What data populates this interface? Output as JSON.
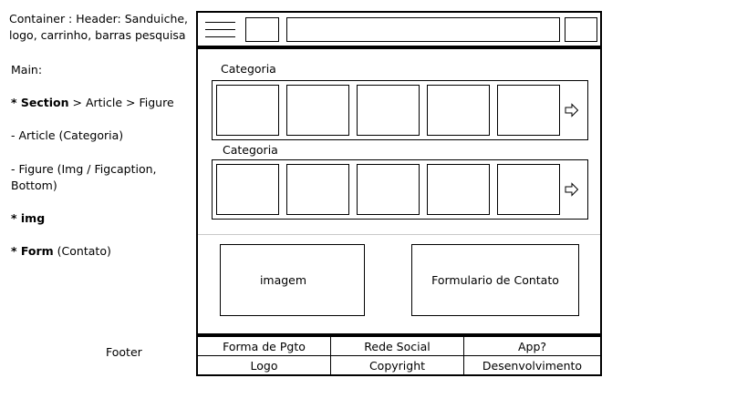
{
  "notes": {
    "header_line1": "Container : Header: Sanduiche,",
    "header_line2": "logo, carrinho, barras pesquisa",
    "main": "Main:",
    "section_bold": "* Section",
    "section_rest": " > Article > Figure",
    "article": "- Article (Categoria)",
    "figure_line1": "- Figure (Img / Figcaption,",
    "figure_line2": "Bottom)",
    "img": "* img",
    "form_bold": "* Form",
    "form_rest": " (Contato)",
    "footer": "Footer"
  },
  "categories": [
    {
      "title": "Categoria"
    },
    {
      "title": "Categoria"
    }
  ],
  "bottom": {
    "image_label": "imagem",
    "form_label": "Formulario de Contato"
  },
  "footer": {
    "row1": [
      "Forma de Pgto",
      "Rede Social",
      "App?"
    ],
    "row2": [
      "Logo",
      "Copyright",
      "Desenvolvimento"
    ]
  }
}
